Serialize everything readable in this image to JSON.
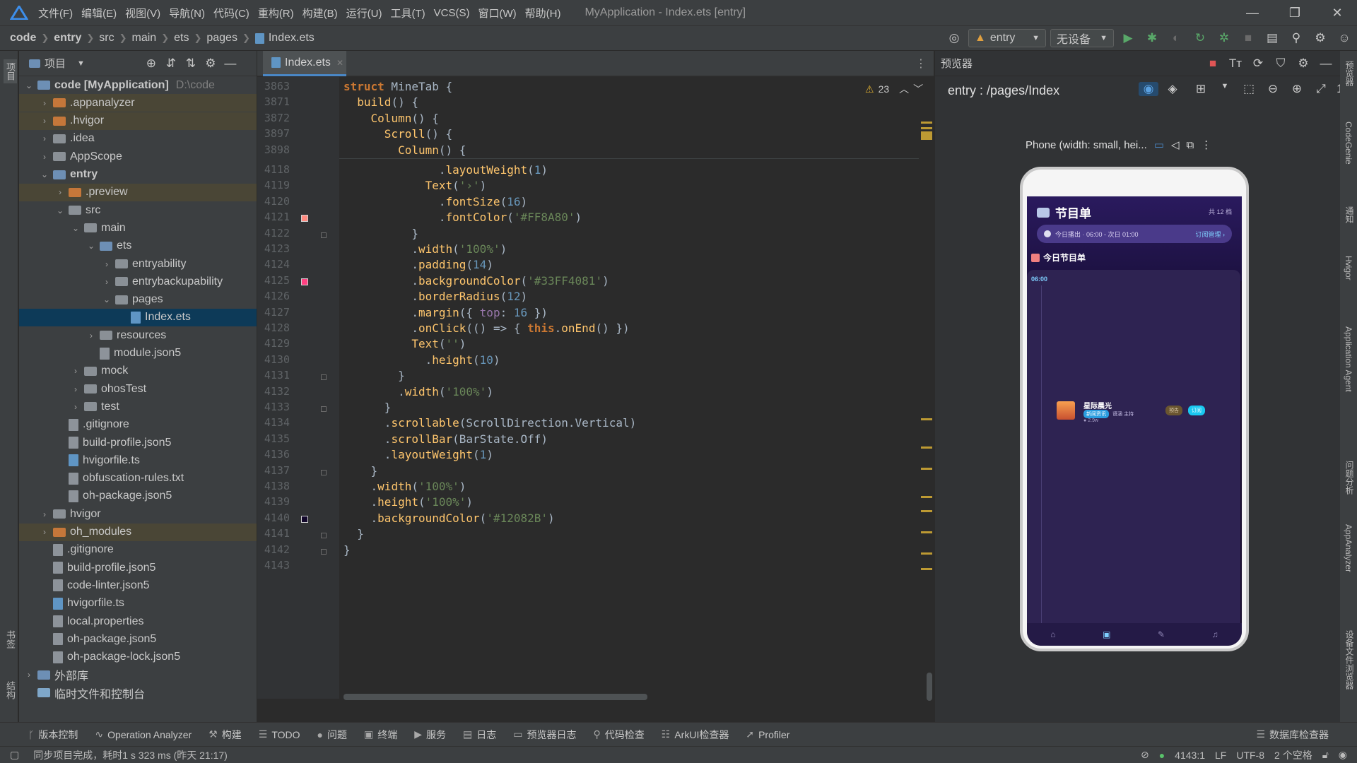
{
  "menubar": {
    "items": [
      "文件(F)",
      "编辑(E)",
      "视图(V)",
      "导航(N)",
      "代码(C)",
      "重构(R)",
      "构建(B)",
      "运行(U)",
      "工具(T)",
      "VCS(S)",
      "窗口(W)",
      "帮助(H)"
    ],
    "title": "MyApplication - Index.ets [entry]"
  },
  "breadcrumb": [
    "code",
    "entry",
    "src",
    "main",
    "ets",
    "pages",
    "Index.ets"
  ],
  "toolbar": {
    "module": "entry",
    "device": "无设备"
  },
  "leftstrip": {
    "project": "项目",
    "bookmarks": "书签",
    "structure": "结构"
  },
  "project": {
    "title": "项目",
    "rows": [
      {
        "label": "code [MyApplication]",
        "extra": "D:\\code",
        "bold": true
      },
      {
        "label": ".appanalyzer"
      },
      {
        "label": ".hvigor"
      },
      {
        "label": ".idea"
      },
      {
        "label": "AppScope"
      },
      {
        "label": "entry",
        "bold": true
      },
      {
        "label": ".preview"
      },
      {
        "label": "src"
      },
      {
        "label": "main"
      },
      {
        "label": "ets"
      },
      {
        "label": "entryability"
      },
      {
        "label": "entrybackupability"
      },
      {
        "label": "pages"
      },
      {
        "label": "Index.ets"
      },
      {
        "label": "resources"
      },
      {
        "label": "module.json5"
      },
      {
        "label": "mock"
      },
      {
        "label": "ohosTest"
      },
      {
        "label": "test"
      },
      {
        "label": ".gitignore"
      },
      {
        "label": "build-profile.json5"
      },
      {
        "label": "hvigorfile.ts"
      },
      {
        "label": "obfuscation-rules.txt"
      },
      {
        "label": "oh-package.json5"
      },
      {
        "label": "hvigor"
      },
      {
        "label": "oh_modules"
      },
      {
        "label": ".gitignore"
      },
      {
        "label": "build-profile.json5"
      },
      {
        "label": "code-linter.json5"
      },
      {
        "label": "hvigorfile.ts"
      },
      {
        "label": "local.properties"
      },
      {
        "label": "oh-package.json5"
      },
      {
        "label": "oh-package-lock.json5"
      },
      {
        "label": "外部库"
      },
      {
        "label": "临时文件和控制台"
      }
    ]
  },
  "editor": {
    "tab": "Index.ets",
    "warnings": "23",
    "sticky": [
      {
        "ln": "3863",
        "code": "struct MineTab {"
      },
      {
        "ln": "3871",
        "code": "  build() {"
      },
      {
        "ln": "3872",
        "code": "    Column() {"
      },
      {
        "ln": "3897",
        "code": "      Scroll() {"
      },
      {
        "ln": "3898",
        "code": "        Column() {"
      }
    ],
    "lines": [
      {
        "ln": "4118",
        "code": "              .layoutWeight(1)"
      },
      {
        "ln": "4119",
        "code": "            Text('›')"
      },
      {
        "ln": "4120",
        "code": "              .fontSize(16)"
      },
      {
        "ln": "4121",
        "code": "              .fontColor('#FF8A80')"
      },
      {
        "ln": "4122",
        "code": "          }"
      },
      {
        "ln": "4123",
        "code": "          .width('100%')"
      },
      {
        "ln": "4124",
        "code": "          .padding(14)"
      },
      {
        "ln": "4125",
        "code": "          .backgroundColor('#33FF4081')"
      },
      {
        "ln": "4126",
        "code": "          .borderRadius(12)"
      },
      {
        "ln": "4127",
        "code": "          .margin({ top: 16 })"
      },
      {
        "ln": "4128",
        "code": "          .onClick(() => { this.onEnd() })"
      },
      {
        "ln": "4129",
        "code": "          Text('')"
      },
      {
        "ln": "4130",
        "code": "            .height(10)"
      },
      {
        "ln": "4131",
        "code": "        }"
      },
      {
        "ln": "4132",
        "code": "        .width('100%')"
      },
      {
        "ln": "4133",
        "code": "      }"
      },
      {
        "ln": "4134",
        "code": "      .scrollable(ScrollDirection.Vertical)"
      },
      {
        "ln": "4135",
        "code": "      .scrollBar(BarState.Off)"
      },
      {
        "ln": "4136",
        "code": "      .layoutWeight(1)"
      },
      {
        "ln": "4137",
        "code": "    }"
      },
      {
        "ln": "4138",
        "code": "    .width('100%')"
      },
      {
        "ln": "4139",
        "code": "    .height('100%')"
      },
      {
        "ln": "4140",
        "code": "    .backgroundColor('#12082B')"
      },
      {
        "ln": "4141",
        "code": "  }"
      },
      {
        "ln": "4142",
        "code": "}"
      },
      {
        "ln": "4143",
        "code": ""
      }
    ]
  },
  "preview": {
    "title": "预览器",
    "route": "entry : /pages/Index",
    "device": "Phone (width: small, hei...",
    "app": {
      "title": "节目单",
      "count": "共 12 档",
      "time": "今日播出 · 06:00 - 次日 01:00",
      "manage": "订阅管理 ›",
      "section": "今日节目单",
      "slot": "06:00",
      "program": "星际晨光",
      "tag": "新闻资讯",
      "host": "语涵 主持",
      "listeners": "2.9w",
      "btn1": "预告",
      "btn2": "订阅"
    }
  },
  "rightstrip": [
    "预览器",
    "CodeGenie",
    "通知",
    "Hvigor",
    "Application Agent",
    "问题分析",
    "AppAnalyzer",
    "设备文件浏览器"
  ],
  "bottombar": {
    "items": [
      "版本控制",
      "Operation Analyzer",
      "构建",
      "TODO",
      "问题",
      "终端",
      "服务",
      "日志",
      "预览器日志",
      "代码检查",
      "ArkUI检查器",
      "Profiler"
    ],
    "db": "数据库检查器"
  },
  "status": {
    "message": "同步项目完成，耗时1 s 323 ms (昨天 21:17)",
    "position": "4143:1",
    "lineending": "LF",
    "encoding": "UTF-8",
    "indent": "2 个空格"
  },
  "colors": {
    "accent": "#4a88c7",
    "bg_editor": "#2b2b2b",
    "bg_panel": "#3c3f41",
    "phone_bg": "#12082B",
    "pink": "#FF8A80"
  }
}
